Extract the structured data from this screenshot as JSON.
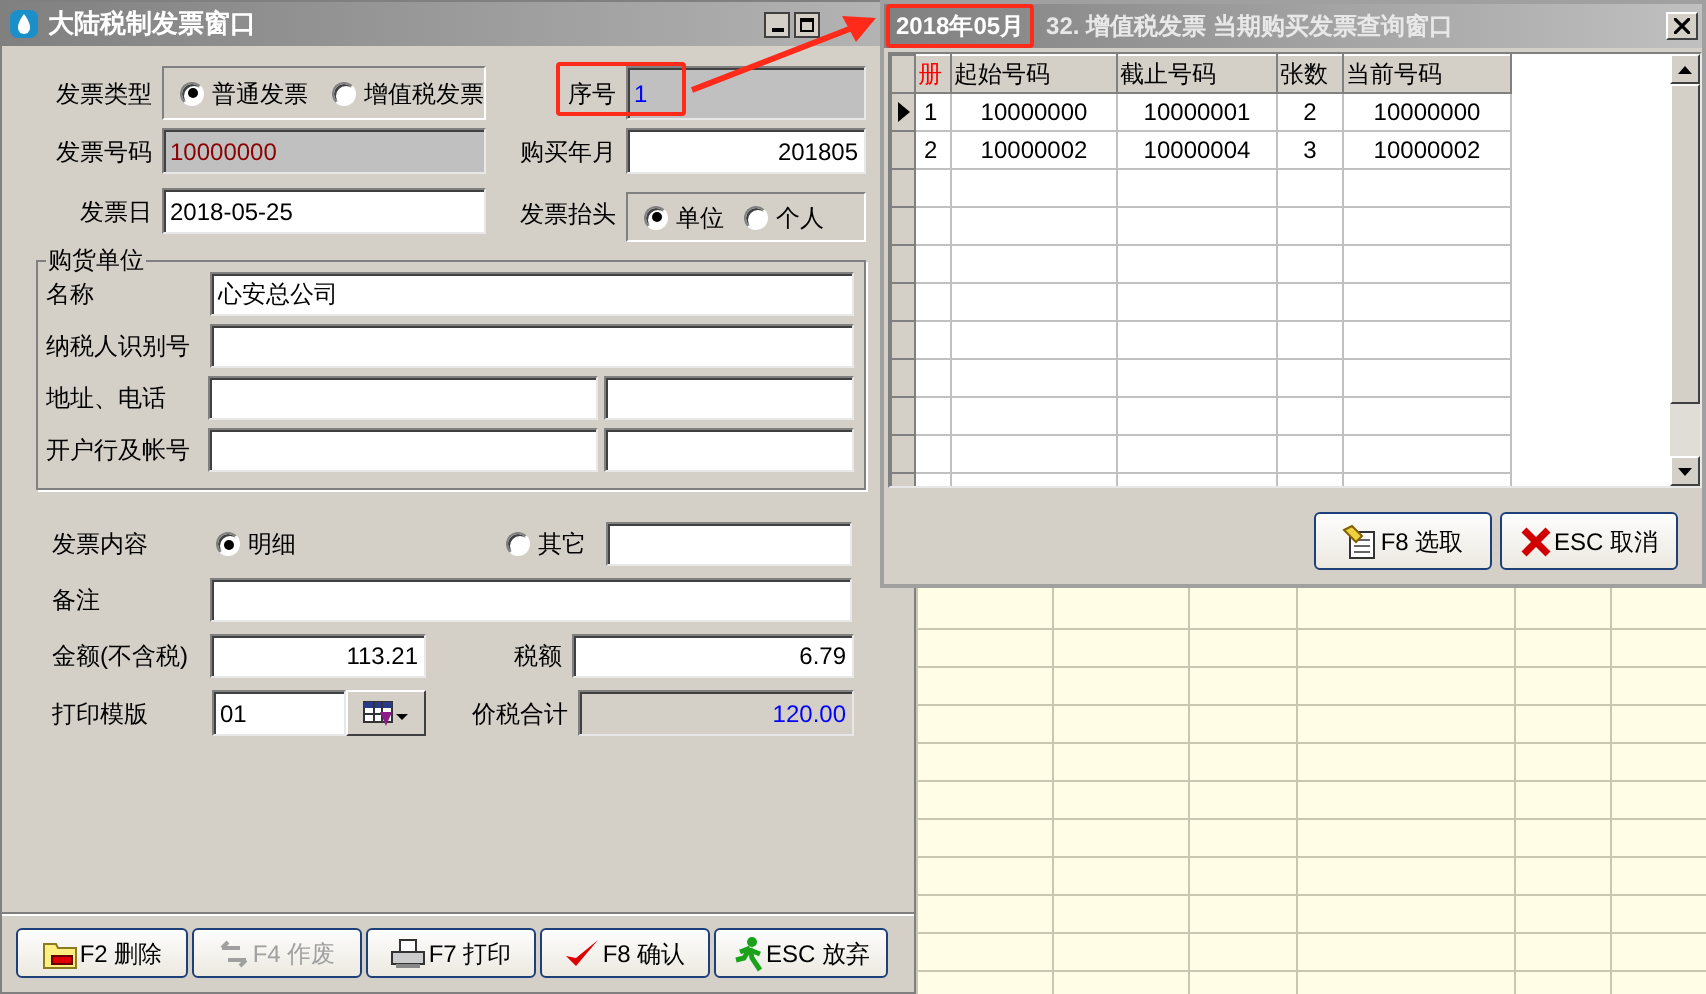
{
  "main_window": {
    "title": "大陆税制发票窗口",
    "invoice_type": {
      "label": "发票类型",
      "options": [
        {
          "label": "普通发票",
          "selected": true
        },
        {
          "label": "增值税发票",
          "selected": false
        }
      ]
    },
    "serial": {
      "label": "序号",
      "value": "1"
    },
    "invoice_number": {
      "label": "发票号码",
      "value": "10000000"
    },
    "purchase_month": {
      "label": "购买年月",
      "value": "201805"
    },
    "invoice_date": {
      "label": "发票日",
      "value": "2018-05-25"
    },
    "invoice_header": {
      "label": "发票抬头",
      "options": [
        {
          "label": "单位",
          "selected": true
        },
        {
          "label": "个人",
          "selected": false
        }
      ]
    },
    "buyer": {
      "title": "购货单位",
      "fields": [
        {
          "label": "名称",
          "kind": "single",
          "value": "心安总公司"
        },
        {
          "label": "纳税人识别号",
          "kind": "single"
        },
        {
          "label": "地址、电话",
          "kind": "double"
        },
        {
          "label": "开户行及帐号",
          "kind": "double"
        }
      ]
    },
    "content": {
      "label": "发票内容",
      "options": [
        {
          "label": "明细",
          "selected": true
        },
        {
          "label": "其它",
          "selected": false
        }
      ]
    },
    "remark": {
      "label": "备注"
    },
    "amount": {
      "label": "金额(不含税)",
      "value": "113.21"
    },
    "tax": {
      "label": "税额",
      "value": "6.79"
    },
    "template": {
      "label": "打印模版",
      "value": "01"
    },
    "total": {
      "label": "价税合计",
      "value": "120.00"
    },
    "buttons": [
      {
        "label": "F2 删除",
        "kind": "delete",
        "disabled": false
      },
      {
        "label": "F4 作废",
        "kind": "void",
        "disabled": true
      },
      {
        "label": "F7 打印",
        "kind": "print",
        "disabled": false
      },
      {
        "label": "F8 确认",
        "kind": "confirm",
        "disabled": false
      },
      {
        "label": "ESC 放弃",
        "kind": "abandon",
        "disabled": false
      }
    ]
  },
  "query_window": {
    "title_period": "2018年05月",
    "title": "32. 增值税发票  当期购买发票查询窗口",
    "table": {
      "columns": [
        "册",
        "起始号码",
        "截止号码",
        "张数",
        "当前号码"
      ],
      "rows": [
        {
          "selected": true,
          "cells": [
            "1",
            "10000000",
            "10000001",
            "2",
            "10000000"
          ]
        },
        {
          "selected": false,
          "cells": [
            "2",
            "10000002",
            "10000004",
            "3",
            "10000002"
          ]
        }
      ]
    },
    "buttons": [
      {
        "label": "F8 选取",
        "kind": "select"
      },
      {
        "label": "ESC 取消",
        "kind": "cancel"
      }
    ]
  }
}
